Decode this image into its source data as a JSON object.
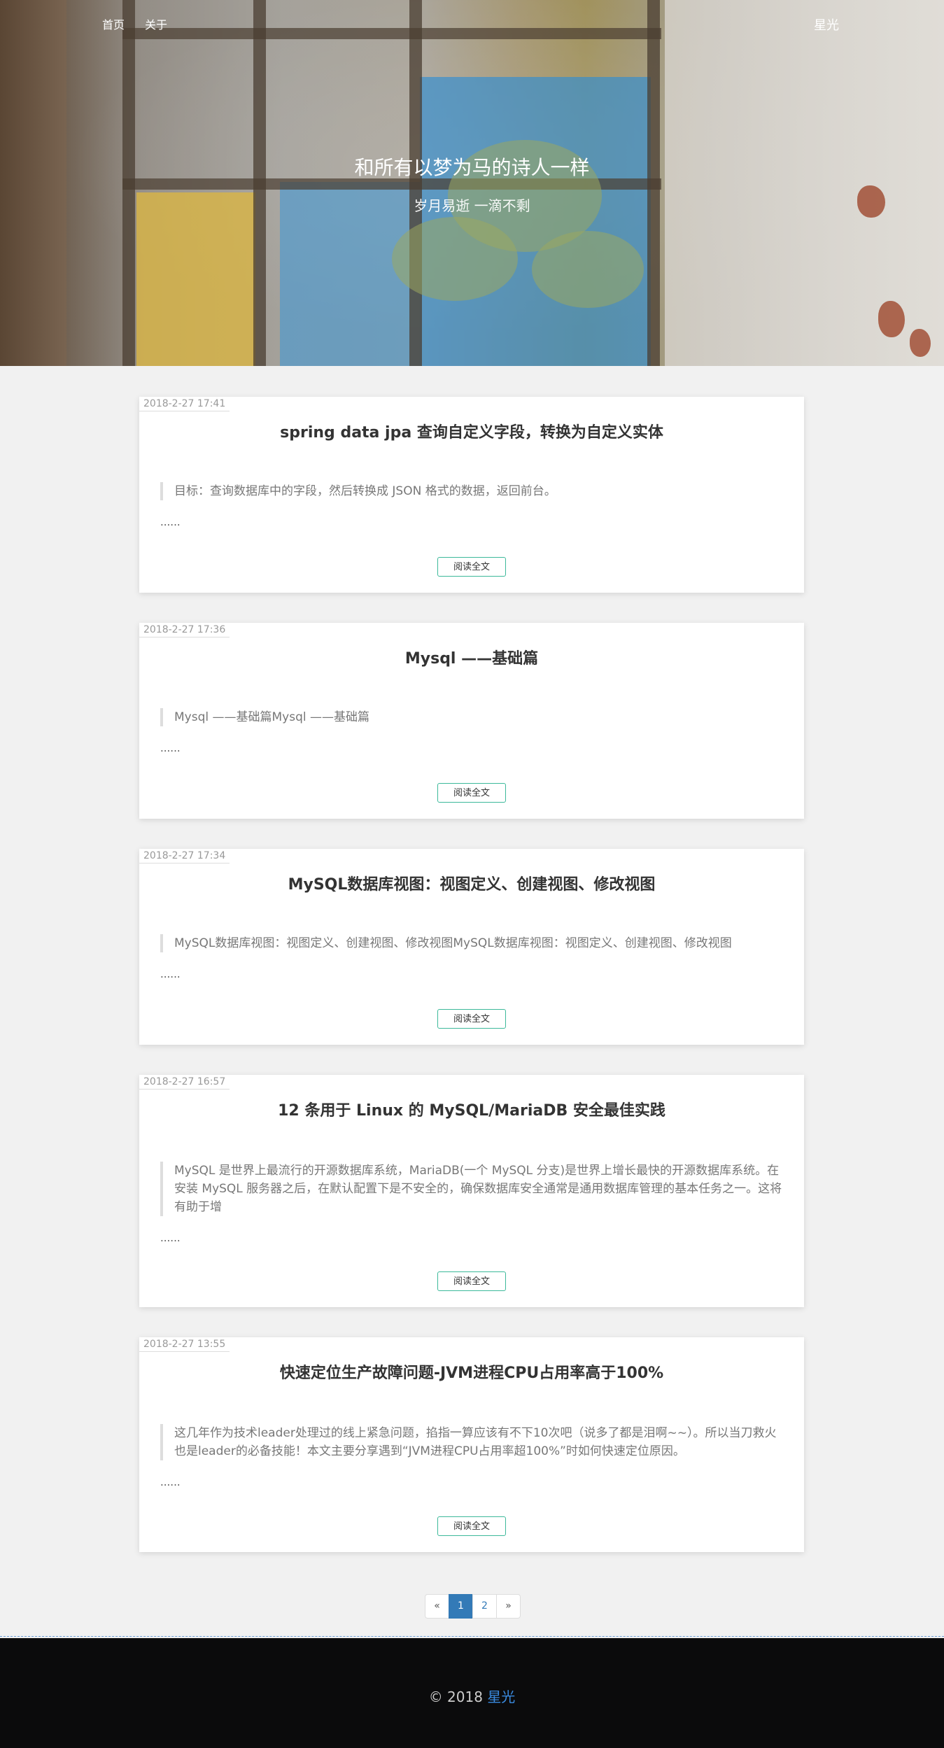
{
  "nav": {
    "home": "首页",
    "about": "关于",
    "brand": "星光"
  },
  "hero": {
    "title": "和所有以梦为马的诗人一样",
    "subtitle": "岁月易逝 一滴不剩"
  },
  "posts": [
    {
      "date": "2018-2-27 17:41",
      "title": "spring data jpa 查询自定义字段，转换为自定义实体",
      "excerpt": "目标：查询数据库中的字段，然后转换成 JSON 格式的数据，返回前台。",
      "ellipsis": "......",
      "button": "阅读全文"
    },
    {
      "date": "2018-2-27 17:36",
      "title": "Mysql ——基础篇",
      "excerpt": "Mysql ——基础篇Mysql ——基础篇",
      "ellipsis": "......",
      "button": "阅读全文"
    },
    {
      "date": "2018-2-27 17:34",
      "title": "MySQL数据库视图：视图定义、创建视图、修改视图",
      "excerpt": "MySQL数据库视图：视图定义、创建视图、修改视图MySQL数据库视图：视图定义、创建视图、修改视图",
      "ellipsis": "......",
      "button": "阅读全文"
    },
    {
      "date": "2018-2-27 16:57",
      "title": "12 条用于 Linux 的 MySQL/MariaDB 安全最佳实践",
      "excerpt": "MySQL 是世界上最流行的开源数据库系统，MariaDB(一个 MySQL 分支)是世界上增长最快的开源数据库系统。在安装 MySQL 服务器之后，在默认配置下是不安全的，确保数据库安全通常是通用数据库管理的基本任务之一。这将有助于增",
      "ellipsis": "......",
      "button": "阅读全文"
    },
    {
      "date": "2018-2-27 13:55",
      "title": "快速定位生产故障问题-JVM进程CPU占用率高于100%",
      "excerpt": "这几年作为技术leader处理过的线上紧急问题，掐指一算应该有不下10次吧（说多了都是泪啊~~）。所以当刀救火也是leader的必备技能！本文主要分享遇到“JVM进程CPU占用率超100%”时如何快速定位原因。",
      "ellipsis": "......",
      "button": "阅读全文"
    }
  ],
  "pagination": {
    "prev": "«",
    "pages": [
      "1",
      "2"
    ],
    "next": "»",
    "active": "1"
  },
  "footer": {
    "copyright": "© 2018",
    "name": "星光"
  }
}
